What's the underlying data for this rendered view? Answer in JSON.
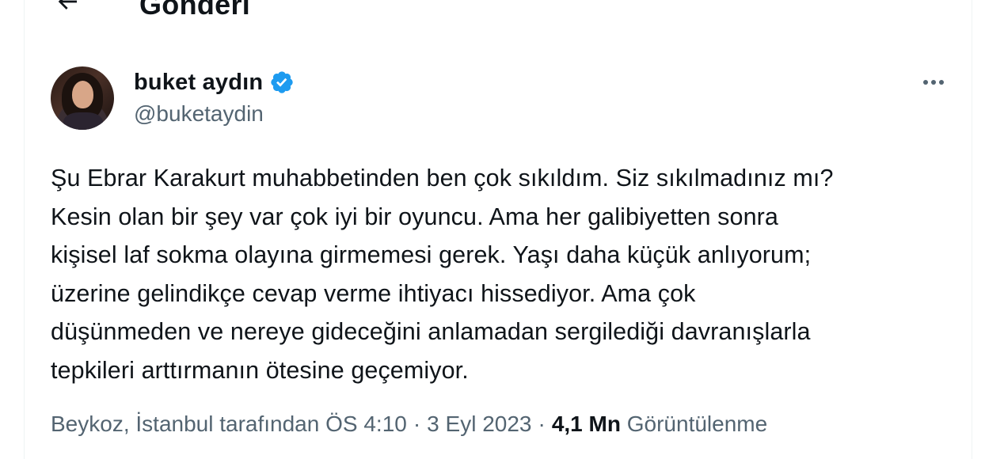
{
  "header": {
    "back_icon": "arrow-left-icon",
    "title": "Gönderi"
  },
  "tweet": {
    "author": {
      "display_name": "buket aydın",
      "handle": "@buketaydin",
      "verified": true,
      "verified_color": "#1d9bf0"
    },
    "more_icon": "more-horizontal-icon",
    "text_lines": [
      "Şu Ebrar Karakurt muhabbetinden ben çok sıkıldım. Siz sıkılmadınız mı?",
      "Kesin olan bir şey var çok iyi bir oyuncu. Ama her galibiyetten sonra",
      "kişisel laf sokma olayına girmemesi gerek. Yaşı daha küçük anlıyorum;",
      "üzerine gelindikçe cevap verme ihtiyacı hissediyor. Ama çok",
      "düşünmeden ve nereye gideceğini anlamadan sergilediği davranışlarla",
      "tepkileri arttırmanın ötesine geçemiyor."
    ],
    "meta": {
      "location_text": "Beykoz, İstanbul tarafından",
      "time": "ÖS 4:10",
      "date": "3 Eyl 2023",
      "separator": "·",
      "views_count": "4,1 Mn",
      "views_label": "Görüntülenme"
    }
  }
}
